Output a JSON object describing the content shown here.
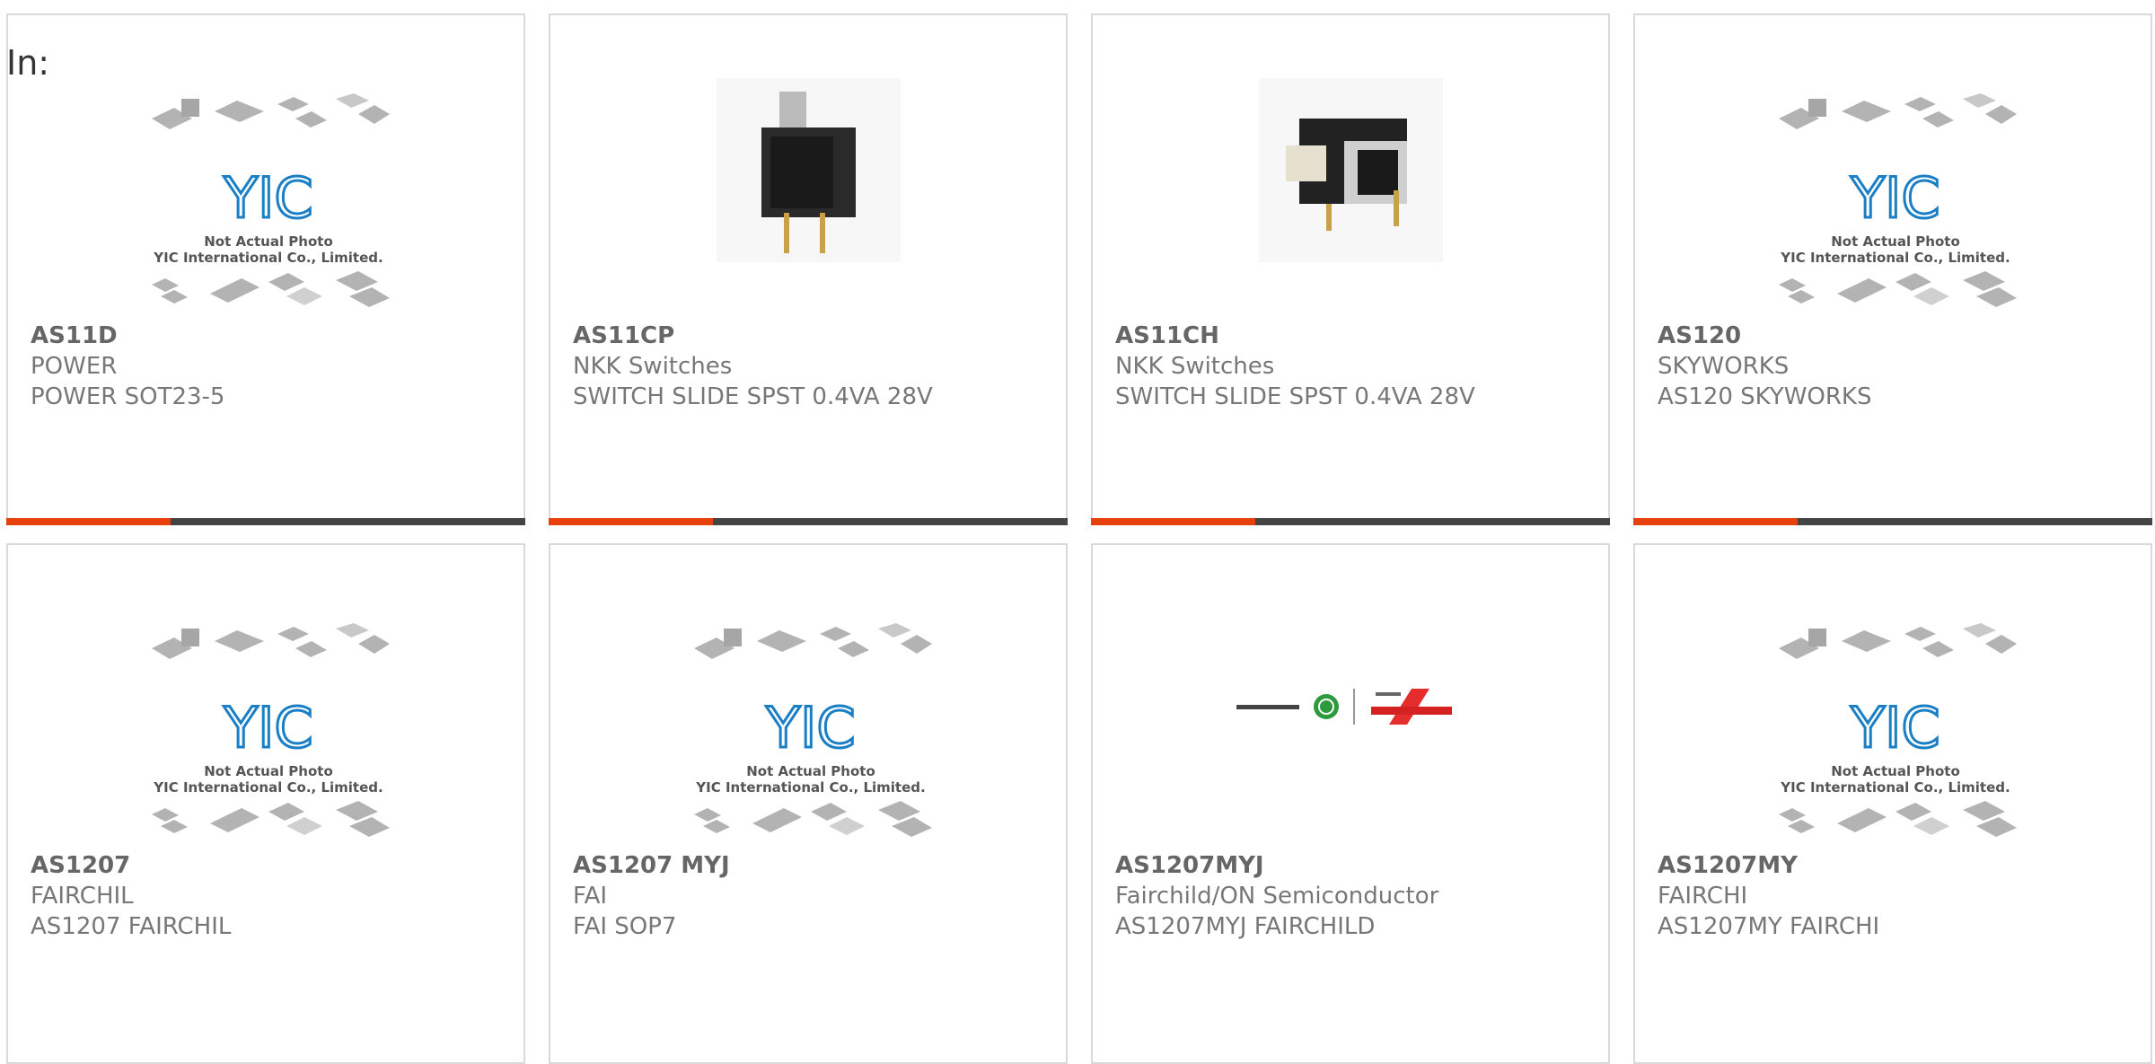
{
  "in_label": "In:",
  "placeholder_photo": {
    "line1": "Not Actual Photo",
    "line2": "YIC International Co., Limited.",
    "logo": "YIC"
  },
  "colors": {
    "accent": "#e8400c",
    "bar": "#444444",
    "logo_blue": "#1a7fc4",
    "chip_gray": "#b0b0b0"
  },
  "products": [
    {
      "part": "AS11D",
      "brand": "POWER",
      "desc": "POWER SOT23-5",
      "image": "placeholder"
    },
    {
      "part": "AS11CP",
      "brand": "NKK Switches",
      "desc": "SWITCH SLIDE SPST 0.4VA 28V",
      "image": "vertical-slide-switch"
    },
    {
      "part": "AS11CH",
      "brand": "NKK Switches",
      "desc": "SWITCH SLIDE SPST 0.4VA 28V",
      "image": "horizontal-slide-switch"
    },
    {
      "part": "AS120",
      "brand": "SKYWORKS",
      "desc": "AS120 SKYWORKS",
      "image": "placeholder"
    },
    {
      "part": "AS1207",
      "brand": "FAIRCHIL",
      "desc": "AS1207 FAIRCHIL",
      "image": "placeholder"
    },
    {
      "part": "AS1207 MYJ",
      "brand": "FAI",
      "desc": "FAI SOP7",
      "image": "placeholder"
    },
    {
      "part": "AS1207MYJ",
      "brand": "Fairchild/ON Semiconductor",
      "desc": "AS1207MYJ FAIRCHILD",
      "image": "on-fairchild-logo"
    },
    {
      "part": "AS1207MY",
      "brand": "FAIRCHI",
      "desc": "AS1207MY FAIRCHI",
      "image": "placeholder"
    }
  ]
}
